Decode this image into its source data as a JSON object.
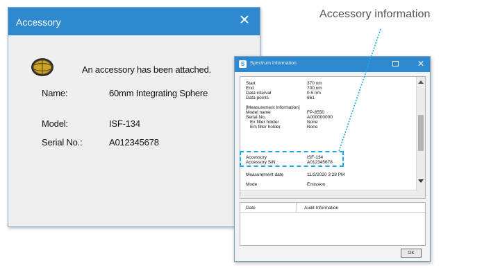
{
  "accessory_dialog": {
    "title": "Accessory",
    "close_glyph": "✕",
    "icon": "integrating-sphere-icon",
    "message": "An accessory has been attached.",
    "fields": [
      {
        "label": "Name:",
        "value": "60mm Integrating Sphere"
      },
      {
        "label": "Model:",
        "value": "ISF-134"
      },
      {
        "label": "Serial No.:",
        "value": "A012345678"
      }
    ]
  },
  "spectrum_window": {
    "title": "Spectrum Information",
    "close_glyph": "✕",
    "info_rows": [
      {
        "label": "Start",
        "value": "370 nm"
      },
      {
        "label": "End",
        "value": "700 nm"
      },
      {
        "label": "Data interval",
        "value": "0.5 nm"
      },
      {
        "label": "Data points",
        "value": "661"
      },
      {
        "label": "[Measurement Information]",
        "value": ""
      },
      {
        "label": "Model name",
        "value": "FP-8550"
      },
      {
        "label": "Serial No.",
        "value": "A000000000"
      },
      {
        "label": "Ex filter holder",
        "value": "None"
      },
      {
        "label": "Em filter holder",
        "value": "None"
      },
      {
        "label": "Accessory",
        "value": "ISF-134"
      },
      {
        "label": "Accessory S/N",
        "value": "A012345678"
      },
      {
        "label": "Measurement date",
        "value": "11/2/2020 3:28 PM"
      },
      {
        "label": "Mode",
        "value": "Emission"
      }
    ],
    "audit_columns": [
      "Date",
      "Audit Information"
    ],
    "ok_label": "OK"
  },
  "annotation": {
    "label": "Accessory information",
    "color": "#1aa9e3"
  },
  "colors": {
    "titlebar": "#2f89cf",
    "dialog_bg": "#efefef"
  }
}
